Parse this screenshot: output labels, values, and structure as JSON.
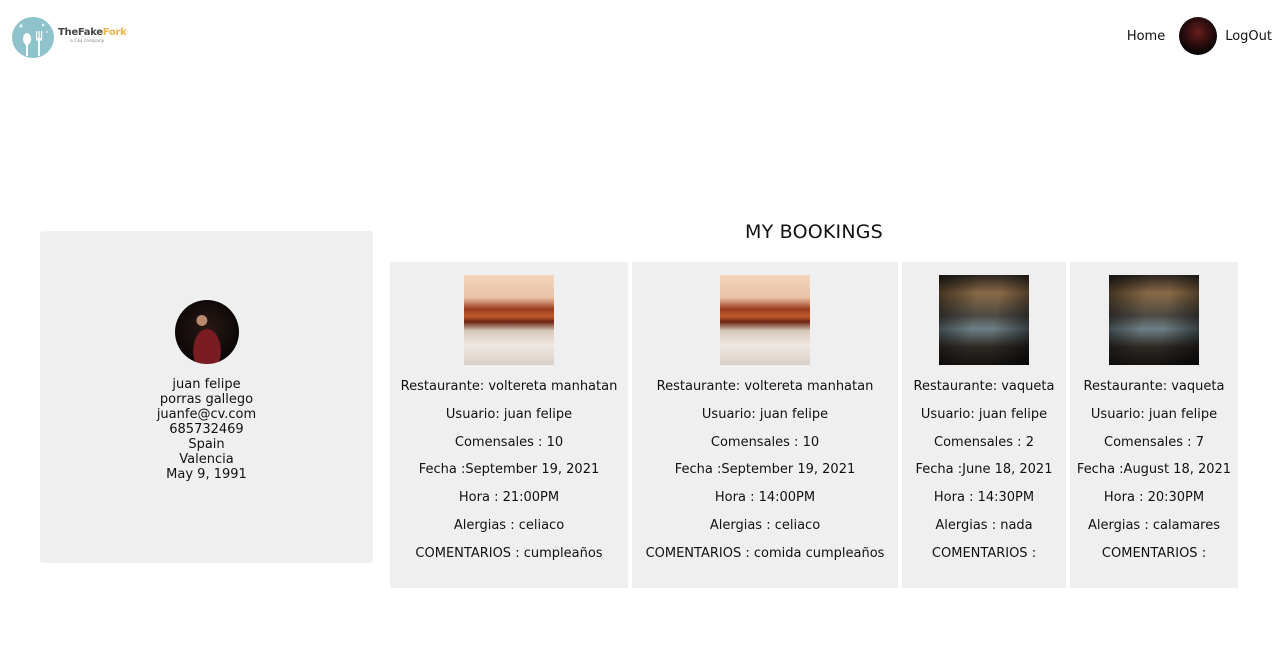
{
  "brand": {
    "name_part1": "TheFake",
    "name_part2": "Fork",
    "tagline": "a C&J company"
  },
  "nav": {
    "home_label": "Home",
    "logout_label": "LogOut"
  },
  "profile": {
    "first_name": "juan felipe",
    "last_name": "porras gallego",
    "email": "juanfe@cv.com",
    "phone": "685732469",
    "country": "Spain",
    "city": "Valencia",
    "birth_date": "May 9, 1991"
  },
  "bookings_title": "MY BOOKINGS",
  "bookings": [
    {
      "restaurante": "Restaurante: voltereta manhatan",
      "usuario": "Usuario: juan felipe",
      "comensales": "Comensales : 10",
      "fecha": "Fecha :September 19, 2021",
      "hora": "Hora : 21:00PM",
      "alergias": "Alergias : celiaco",
      "comentarios": "COMENTARIOS : cumpleaños"
    },
    {
      "restaurante": "Restaurante: voltereta manhatan",
      "usuario": "Usuario: juan felipe",
      "comensales": "Comensales : 10",
      "fecha": "Fecha :September 19, 2021",
      "hora": "Hora : 14:00PM",
      "alergias": "Alergias : celiaco",
      "comentarios": "COMENTARIOS : comida cumpleaños"
    },
    {
      "restaurante": "Restaurante: vaqueta",
      "usuario": "Usuario: juan felipe",
      "comensales": "Comensales : 2",
      "fecha": "Fecha :June 18, 2021",
      "hora": "Hora : 14:30PM",
      "alergias": "Alergias : nada",
      "comentarios": "COMENTARIOS :"
    },
    {
      "restaurante": "Restaurante: vaqueta",
      "usuario": "Usuario: juan felipe",
      "comensales": "Comensales : 7",
      "fecha": "Fecha :August 18, 2021",
      "hora": "Hora : 20:30PM",
      "alergias": "Alergias : calamares",
      "comentarios": "COMENTARIOS :"
    }
  ]
}
